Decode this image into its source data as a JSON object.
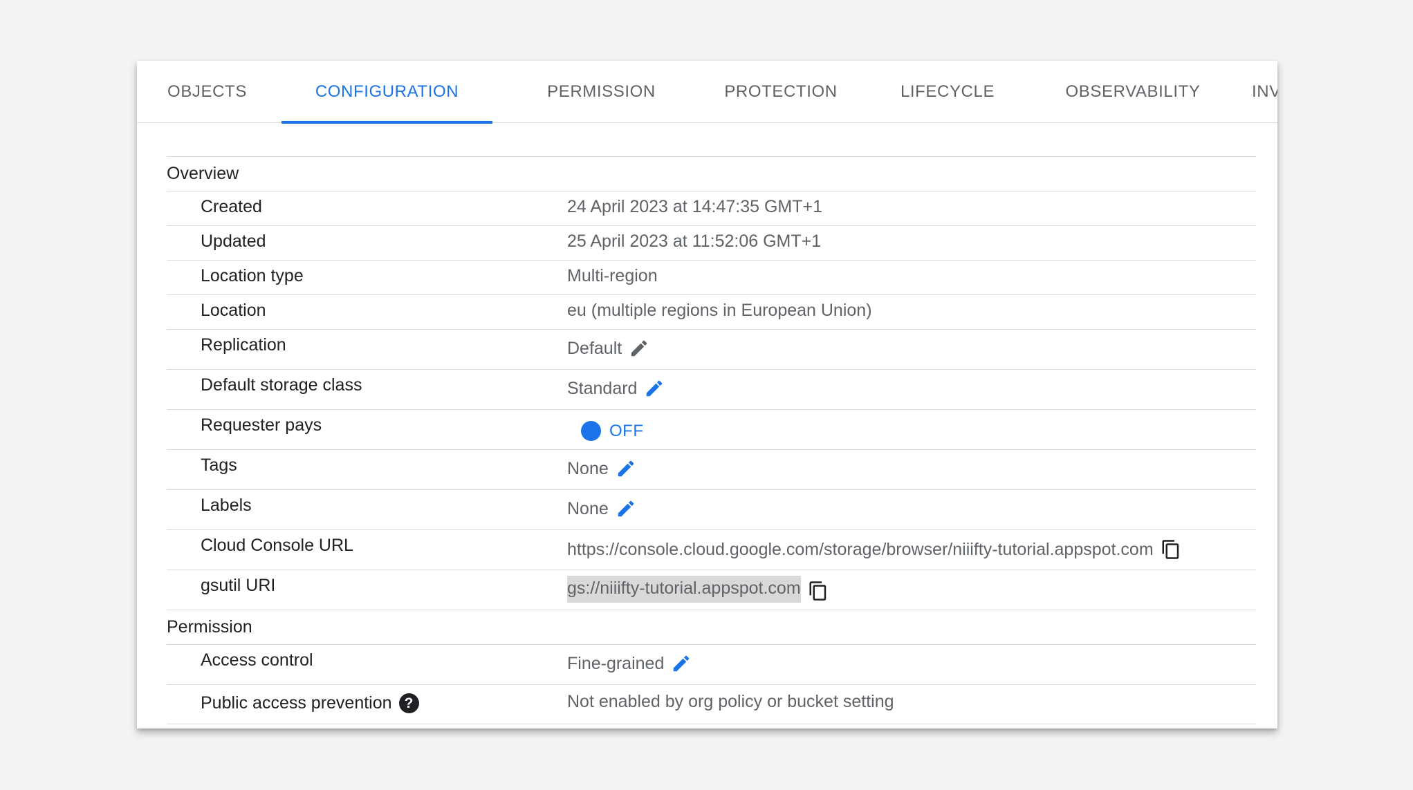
{
  "tabs": [
    {
      "label": "OBJECTS",
      "active": false
    },
    {
      "label": "CONFIGURATION",
      "active": true
    },
    {
      "label": "PERMISSION",
      "active": false
    },
    {
      "label": "PROTECTION",
      "active": false
    },
    {
      "label": "LIFECYCLE",
      "active": false
    },
    {
      "label": "OBSERVABILITY",
      "active": false
    },
    {
      "label": "INV",
      "active": false
    }
  ],
  "overview": {
    "title": "Overview",
    "created": {
      "label": "Created",
      "value": "24 April 2023 at 14:47:35 GMT+1"
    },
    "updated": {
      "label": "Updated",
      "value": "25 April 2023 at 11:52:06 GMT+1"
    },
    "location_type": {
      "label": "Location type",
      "value": "Multi-region"
    },
    "location": {
      "label": "Location",
      "value": "eu (multiple regions in European Union)"
    },
    "replication": {
      "label": "Replication",
      "value": "Default"
    },
    "storage_class": {
      "label": "Default storage class",
      "value": "Standard"
    },
    "requester_pays": {
      "label": "Requester pays",
      "value": "OFF"
    },
    "tags": {
      "label": "Tags",
      "value": "None"
    },
    "labels": {
      "label": "Labels",
      "value": "None"
    },
    "console_url": {
      "label": "Cloud Console URL",
      "value": "https://console.cloud.google.com/storage/browser/niiifty-tutorial.appspot.com"
    },
    "gsutil_uri": {
      "label": "gsutil URI",
      "value": "gs://niiifty-tutorial.appspot.com"
    }
  },
  "permission": {
    "title": "Permission",
    "access_control": {
      "label": "Access control",
      "value": "Fine-grained"
    },
    "public_access": {
      "label": "Public access prevention",
      "value": "Not enabled by org policy or bucket setting",
      "help_glyph": "?"
    }
  },
  "colors": {
    "accent": "#1a73e8",
    "disabled_edit": "#5f6368",
    "text_primary": "#202124",
    "text_secondary": "#5f6368",
    "highlight": "#d9d9d9"
  },
  "icons": {
    "edit": "pencil-icon",
    "copy": "copy-icon",
    "help": "help-icon"
  }
}
